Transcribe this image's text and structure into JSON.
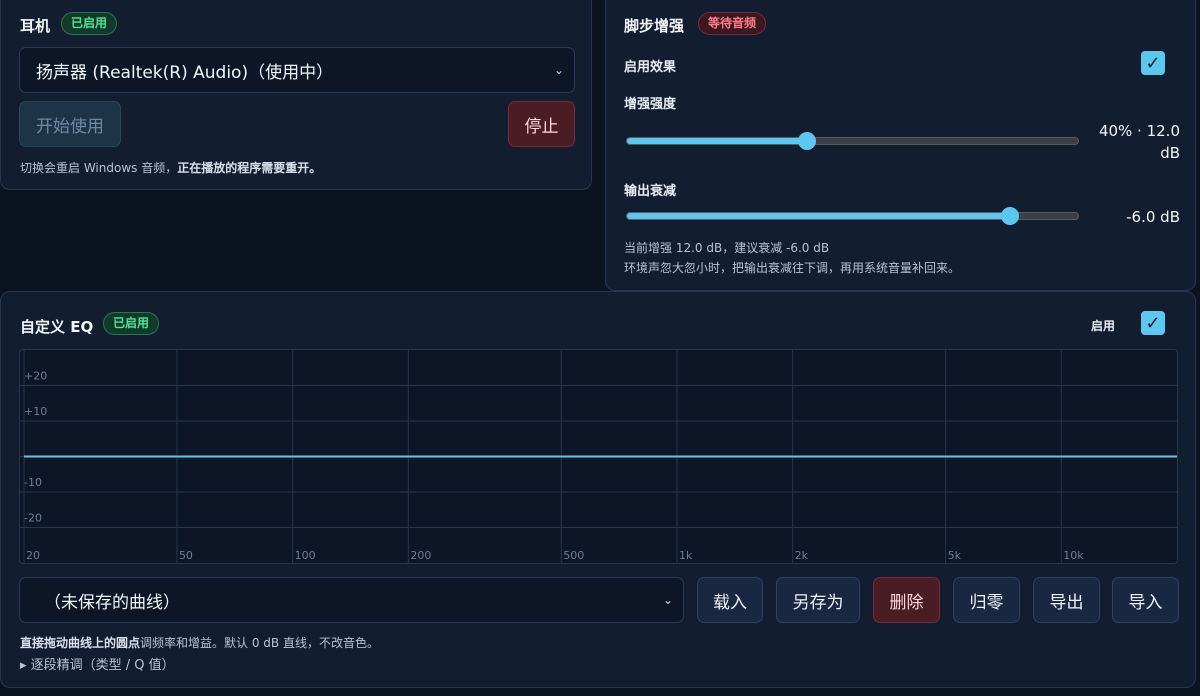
{
  "headphone": {
    "title": "耳机",
    "badge": "已启用",
    "device_select": "扬声器 (Realtek(R) Audio)（使用中）",
    "start_button": "开始使用",
    "stop_button": "停止",
    "note_plain": "切换会重启 Windows 音频，",
    "note_bold": "正在播放的程序需要重开。"
  },
  "footstep": {
    "title": "脚步增强",
    "badge": "等待音频",
    "enable_label": "启用效果",
    "enabled": true,
    "strength_label": "增强强度",
    "strength_value": "40% · 12.0 dB",
    "strength_percent": 40,
    "attenuation_label": "输出衰减",
    "attenuation_value": "-6.0 dB",
    "attenuation_fraction": 0.85,
    "info_line1": "当前增强 12.0 dB，建议衰减 -6.0 dB",
    "info_line2": "环境声忽大忽小时，把输出衰减往下调，再用系统音量补回来。"
  },
  "eq": {
    "title": "自定义 EQ",
    "badge": "已启用",
    "enable_label": "启用",
    "enabled": true,
    "curve_select": "（未保存的曲线）",
    "load_button": "载入",
    "save_as_button": "另存为",
    "delete_button": "删除",
    "reset_button": "归零",
    "export_button": "导出",
    "import_button": "导入",
    "hint_bold": "直接拖动曲线上的圆点",
    "hint_plain": "调频率和增益。默认 0 dB 直线，不改音色。",
    "advanced_toggle": "▸ 逐段精调（类型 / Q 值）"
  },
  "chart_data": {
    "type": "line",
    "x_scale": "log",
    "xlim": [
      20,
      20000
    ],
    "ylim": [
      -30,
      30
    ],
    "x_ticks": [
      20,
      50,
      100,
      200,
      500,
      1000,
      2000,
      5000,
      10000
    ],
    "x_tick_labels": [
      "20",
      "50",
      "100",
      "200",
      "500",
      "1k",
      "2k",
      "5k",
      "10k"
    ],
    "y_ticks": [
      20,
      10,
      -10,
      -20
    ],
    "y_tick_labels": [
      "+20",
      "+10",
      "-10",
      "-20"
    ],
    "series": [
      {
        "x": [
          20,
          20000
        ],
        "y": [
          0,
          0
        ]
      }
    ],
    "grid": true,
    "colors": {
      "curve": "#5cc8f0",
      "grid": "#26364f",
      "tick": "#6f7f96"
    }
  }
}
